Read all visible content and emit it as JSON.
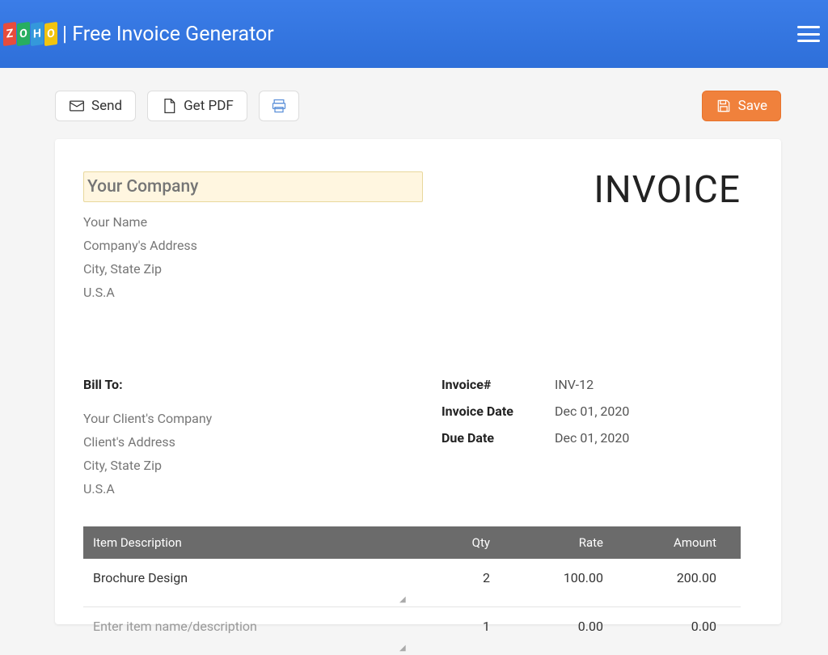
{
  "header": {
    "title": "| Free Invoice Generator"
  },
  "toolbar": {
    "send_label": "Send",
    "getpdf_label": "Get PDF",
    "save_label": "Save"
  },
  "invoice": {
    "title": "INVOICE",
    "company_placeholder": "Your Company",
    "from_lines": {
      "name": "Your Name",
      "address": "Company's Address",
      "citystate": "City, State Zip",
      "country": "U.S.A"
    },
    "bill_to_label": "Bill To:",
    "bill_to_lines": {
      "company": "Your Client's Company",
      "address": "Client's Address",
      "citystate": "City, State Zip",
      "country": "U.S.A"
    },
    "meta": {
      "number_label": "Invoice#",
      "number_value": "INV-12",
      "date_label": "Invoice Date",
      "date_value": "Dec 01, 2020",
      "due_label": "Due Date",
      "due_value": "Dec 01, 2020"
    },
    "table": {
      "headers": {
        "desc": "Item Description",
        "qty": "Qty",
        "rate": "Rate",
        "amount": "Amount"
      },
      "row1": {
        "desc": "Brochure Design",
        "qty": "2",
        "rate": "100.00",
        "amount": "200.00"
      },
      "row2": {
        "desc_placeholder": "Enter item name/description",
        "qty": "1",
        "rate": "0.00",
        "amount": "0.00"
      }
    }
  }
}
